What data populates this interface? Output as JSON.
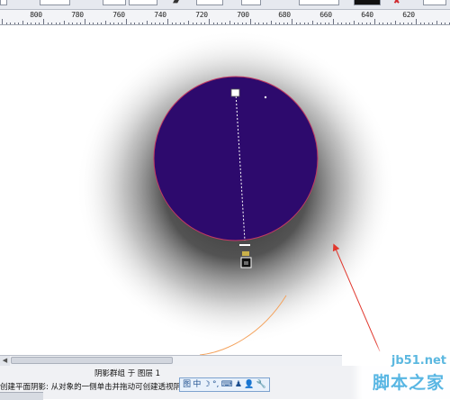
{
  "toolbar": {
    "colors": {
      "strip": "#e6e9ef",
      "swatch_black": "#111111",
      "red_icon": "#d0272b"
    }
  },
  "ruler": {
    "labels": [
      "800",
      "780",
      "760",
      "740",
      "720",
      "700",
      "680",
      "660",
      "640",
      "620"
    ]
  },
  "canvas": {
    "circle_fill": "#2d0a6d",
    "circle_outline": "#c33a62",
    "shadow_color": "#4a4a4a",
    "arrow_color": "#e1382e",
    "arc_color": "#f4a25c"
  },
  "status": {
    "line1": "阴影群组 于 图层 1",
    "line2": "创建平面阴影: 从对象的一侧单击并拖动可创建透视阴影"
  },
  "ime": {
    "items": [
      "图",
      "中",
      "☽",
      "°,",
      "⌨",
      "♟",
      "👤",
      "🔧"
    ]
  },
  "watermark": {
    "top": "jb51.net",
    "bottom": "脚本之家"
  }
}
